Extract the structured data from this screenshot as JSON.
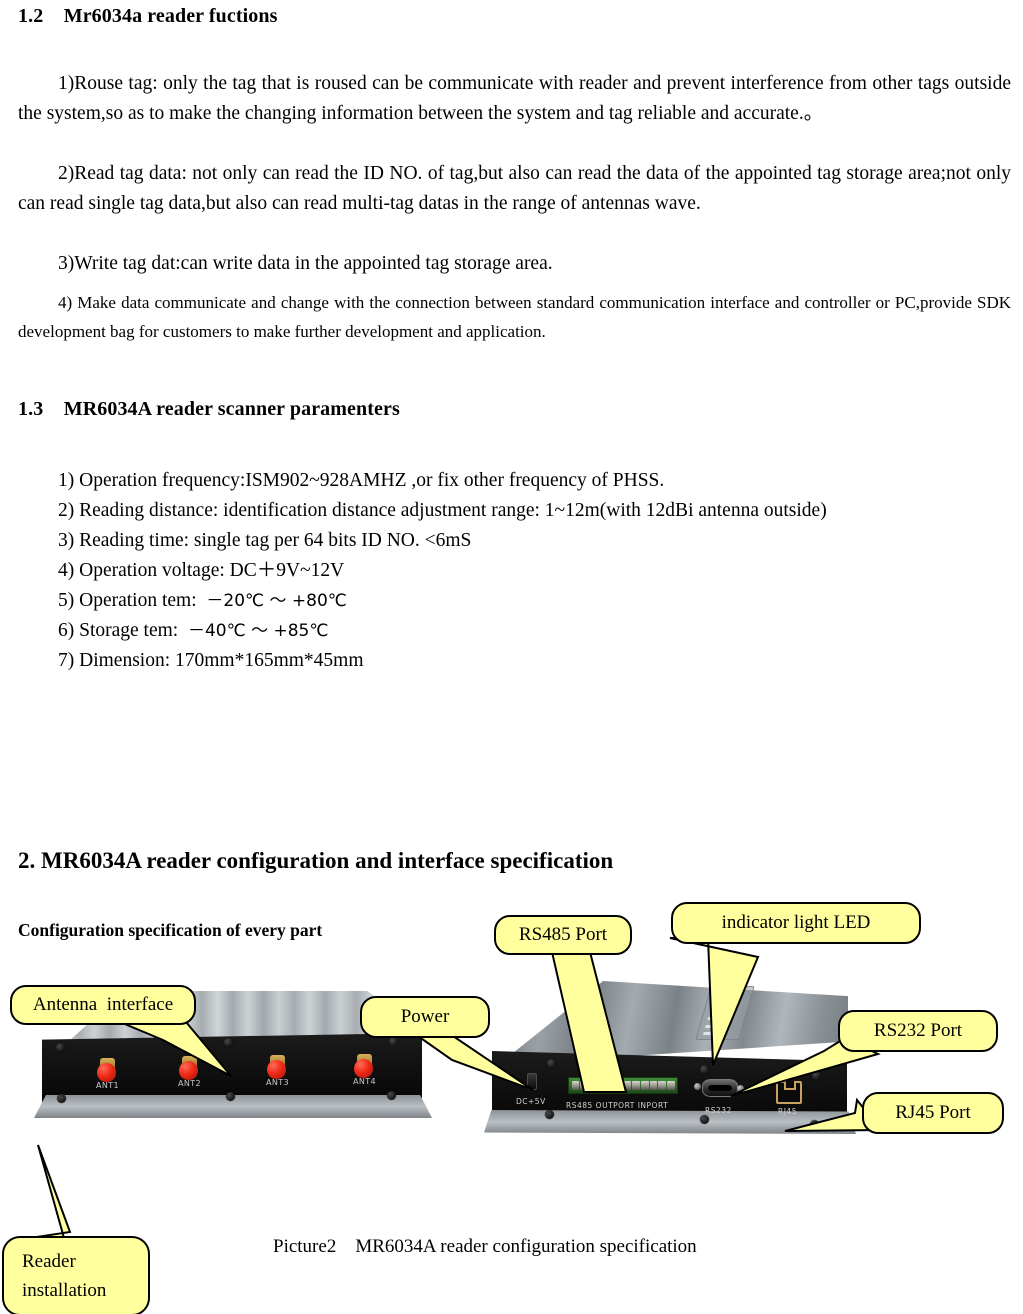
{
  "sections": {
    "s12": {
      "number": "1.2",
      "title": "Mr6034a reader fuctions",
      "items": [
        "1)Rouse tag: only the tag that is roused can be communicate with reader and prevent interference from other tags outside the system,so as to make the changing information between the system and tag reliable and accurate.。",
        "2)Read tag data: not only can read the ID NO. of tag,but also can read the data of the appointed tag storage area;not only can read single tag data,but also can read multi-tag datas in the range of antennas wave.",
        "3)Write tag dat:can write data in the appointed tag storage area.",
        "4) Make data communicate and change with the connection between    standard communication interface and controller or PC,provide SDK development bag for customers to make further development and application."
      ]
    },
    "s13": {
      "number": "1.3",
      "title": "MR6034A reader scanner paramenters",
      "specs": [
        "1) Operation frequency:ISM902~928AMHZ ,or fix other frequency of PHSS.",
        "2) Reading distance: identification distance adjustment range: 1~12m(with 12dBi antenna outside)",
        "3) Reading time: single tag per 64 bits ID NO. <6mS",
        "4) Operation voltage: DC＋9V~12V",
        "5) Operation tem:  －20℃ ～ +80℃",
        "6) Storage tem:  －40℃ ～ +85℃",
        "7) Dimension: 170mm*165mm*45mm"
      ],
      "spec_parts": {
        "s1": "1) Operation frequency:ISM902~928AMHZ ,or fix other frequency of PHSS.",
        "s2": "2) Reading distance: identification distance adjustment range: 1~12m(with 12dBi antenna outside)",
        "s3": "3) Reading time: single tag per 64 bits ID NO. <6mS",
        "s4": "4) Operation voltage: DC＋9V~12V",
        "s5a": "5) Operation tem:  ",
        "s5b": "－20℃ ～ +80℃",
        "s6a": "6) Storage tem:  ",
        "s6b": "－40℃ ～ +85℃",
        "s7": "7) Dimension: 170mm*165mm*45mm"
      }
    },
    "s2": {
      "title": "2. MR6034A reader configuration and interface specification",
      "config_title": "Configuration specification of every part",
      "caption": "Picture2    MR6034A reader configuration specification"
    }
  },
  "callouts": {
    "antenna": "Antenna  interface",
    "power": "Power",
    "rs485": "RS485 Port",
    "led": "indicator light LED",
    "rs232": "RS232 Port",
    "rj45": "RJ45 Port",
    "reader_install": "Reader installation"
  },
  "photo": {
    "left_device_labels": [
      "ANT1",
      "ANT2",
      "ANT3",
      "ANT4"
    ],
    "right_device_labels": {
      "dc": "DC+5V",
      "rs485": "RS485 OUTPORT INPORT",
      "rs232": "RS232",
      "rj45": "RJ45"
    }
  },
  "colors": {
    "callout_fill": "#ffff9e",
    "callout_border": "#000000",
    "page_background": "#ffffff",
    "text": "#000000"
  }
}
